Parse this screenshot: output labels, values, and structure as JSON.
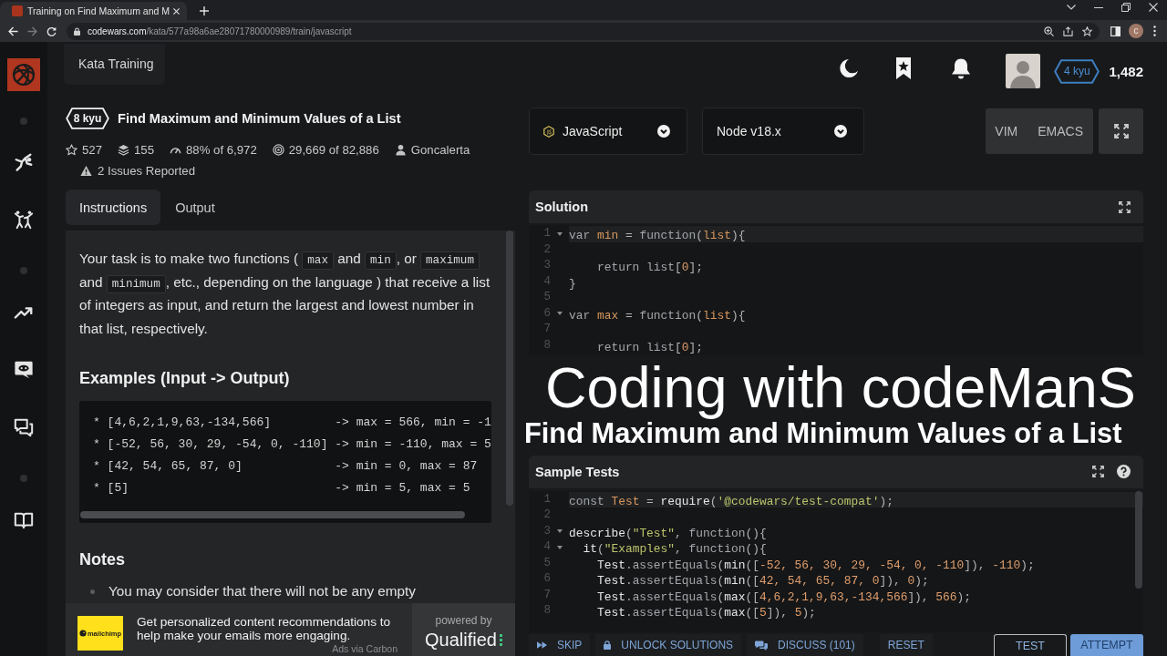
{
  "browser": {
    "tab_title": "Training on Find Maximum and M",
    "url_host": "codewars.com",
    "url_path": "/kata/577a98a6ae28071780000989/train/javascript",
    "back_disabled": false,
    "forward_disabled": true,
    "profile_initial": "c"
  },
  "header": {
    "title": "Kata Training",
    "rank": "4 kyu",
    "honor": "1,482"
  },
  "kata": {
    "rank": "8 kyu",
    "title": "Find Maximum and Minimum Values of a List",
    "stats": [
      {
        "kind": "favorites",
        "text": "527"
      },
      {
        "kind": "collections",
        "text": "155"
      },
      {
        "kind": "satisfaction",
        "text": "88% of 6,972"
      },
      {
        "kind": "completions",
        "text": "29,669 of 82,886"
      },
      {
        "kind": "author",
        "text": "Goncalerta"
      }
    ],
    "issues": "2 Issues Reported"
  },
  "tabs": [
    {
      "label": "Instructions",
      "selected": true
    },
    {
      "label": "Output",
      "selected": false
    }
  ],
  "instructions": {
    "paragraph": [
      {
        "kind": "text",
        "text": "Your task is to make two functions ( "
      },
      {
        "kind": "code",
        "text": "max"
      },
      {
        "kind": "text",
        "text": " and "
      },
      {
        "kind": "code",
        "text": "min"
      },
      {
        "kind": "text",
        "text": ", or "
      },
      {
        "kind": "code",
        "text": "maximum"
      },
      {
        "kind": "text",
        "text": " and "
      },
      {
        "kind": "code",
        "text": "minimum"
      },
      {
        "kind": "text",
        "text": ", etc., depending on the language ) that receive a list of integers as input, and return the largest and lowest number in that list, respectively."
      }
    ],
    "examples_heading": "Examples (Input -> Output)",
    "examples": [
      "* [4,6,2,1,9,63,-134,566]         -> max = 566, min = -1",
      "* [-52, 56, 30, 29, -54, 0, -110] -> min = -110, max = 5",
      "* [42, 54, 65, 87, 0]             -> min = 0, max = 87",
      "* [5]                             -> min = 5, max = 5"
    ],
    "notes_heading": "Notes",
    "notes": [
      "You may consider that there will not be any empty"
    ]
  },
  "ad": {
    "logo_text": "mailchimp",
    "text": "Get personalized content recommendations to help make your emails more engaging.",
    "source": "Ads via Carbon",
    "powered_by": "powered by",
    "brand": "Qualified"
  },
  "editor_toolbar": {
    "language": "JavaScript",
    "runtime": "Node v18.x",
    "modes": [
      "VIM",
      "EMACS"
    ]
  },
  "solution": {
    "title": "Solution",
    "lines": [
      {
        "number": "1",
        "fold": true,
        "active": true,
        "tokens": [
          {
            "kind": "kw",
            "text": "var "
          },
          {
            "kind": "var",
            "text": "min"
          },
          {
            "kind": "punc",
            "text": " = "
          },
          {
            "kind": "kw",
            "text": "function"
          },
          {
            "kind": "punc",
            "text": "("
          },
          {
            "kind": "var",
            "text": "list"
          },
          {
            "kind": "punc",
            "text": "){"
          }
        ]
      },
      {
        "number": "2",
        "fold": false,
        "active": false
      },
      {
        "number": "3",
        "fold": false,
        "active": false,
        "tokens": [
          {
            "kind": "kw",
            "text": "    return list"
          },
          {
            "kind": "punc",
            "text": "["
          },
          {
            "kind": "num",
            "text": "0"
          },
          {
            "kind": "punc",
            "text": "];"
          }
        ]
      },
      {
        "number": "4",
        "fold": false,
        "active": false,
        "tokens": [
          {
            "kind": "punc",
            "text": "}"
          }
        ]
      },
      {
        "number": "5",
        "fold": false,
        "active": false
      },
      {
        "number": "6",
        "fold": true,
        "active": false,
        "tokens": [
          {
            "kind": "kw",
            "text": "var "
          },
          {
            "kind": "var",
            "text": "max"
          },
          {
            "kind": "punc",
            "text": " = "
          },
          {
            "kind": "kw",
            "text": "function"
          },
          {
            "kind": "punc",
            "text": "("
          },
          {
            "kind": "var",
            "text": "list"
          },
          {
            "kind": "punc",
            "text": "){"
          }
        ]
      },
      {
        "number": "7",
        "fold": false,
        "active": false
      },
      {
        "number": "8",
        "fold": false,
        "active": false,
        "tokens": [
          {
            "kind": "kw",
            "text": "    return list"
          },
          {
            "kind": "punc",
            "text": "["
          },
          {
            "kind": "num",
            "text": "0"
          },
          {
            "kind": "punc",
            "text": "];"
          }
        ]
      }
    ]
  },
  "sample_tests": {
    "title": "Sample Tests",
    "lines": [
      {
        "number": "1",
        "fold": false,
        "active": true,
        "tokens": [
          {
            "kind": "kw",
            "text": "const "
          },
          {
            "kind": "var",
            "text": "Test"
          },
          {
            "kind": "punc",
            "text": " = "
          },
          {
            "kind": "fn",
            "text": "require"
          },
          {
            "kind": "punc",
            "text": "("
          },
          {
            "kind": "str",
            "text": "'@codewars/test-compat'"
          },
          {
            "kind": "punc",
            "text": ");"
          }
        ]
      },
      {
        "number": "2",
        "fold": false,
        "active": false
      },
      {
        "number": "3",
        "fold": true,
        "active": false,
        "tokens": [
          {
            "kind": "fn",
            "text": "describe"
          },
          {
            "kind": "punc",
            "text": "("
          },
          {
            "kind": "str",
            "text": "\"Test\""
          },
          {
            "kind": "punc",
            "text": ", "
          },
          {
            "kind": "kw",
            "text": "function"
          },
          {
            "kind": "punc",
            "text": "(){"
          }
        ]
      },
      {
        "number": "4",
        "fold": true,
        "active": false,
        "tokens": [
          {
            "kind": "fn",
            "text": "  it"
          },
          {
            "kind": "punc",
            "text": "("
          },
          {
            "kind": "str",
            "text": "\"Examples\""
          },
          {
            "kind": "punc",
            "text": ", "
          },
          {
            "kind": "kw",
            "text": "function"
          },
          {
            "kind": "punc",
            "text": "(){"
          }
        ]
      },
      {
        "number": "5",
        "fold": false,
        "active": false,
        "tokens": [
          {
            "kind": "fn",
            "text": "    Test"
          },
          {
            "kind": "kw",
            "text": ".assertEquals"
          },
          {
            "kind": "punc",
            "text": "("
          },
          {
            "kind": "fn",
            "text": "min"
          },
          {
            "kind": "punc",
            "text": "(["
          },
          {
            "kind": "num",
            "text": "-52, 56, 30, 29, -54, 0, -110"
          },
          {
            "kind": "punc",
            "text": "]), "
          },
          {
            "kind": "num",
            "text": "-110"
          },
          {
            "kind": "punc",
            "text": ");"
          }
        ]
      },
      {
        "number": "6",
        "fold": false,
        "active": false,
        "tokens": [
          {
            "kind": "fn",
            "text": "    Test"
          },
          {
            "kind": "kw",
            "text": ".assertEquals"
          },
          {
            "kind": "punc",
            "text": "("
          },
          {
            "kind": "fn",
            "text": "min"
          },
          {
            "kind": "punc",
            "text": "(["
          },
          {
            "kind": "num",
            "text": "42, 54, 65, 87, 0"
          },
          {
            "kind": "punc",
            "text": "]), "
          },
          {
            "kind": "num",
            "text": "0"
          },
          {
            "kind": "punc",
            "text": ");"
          }
        ]
      },
      {
        "number": "7",
        "fold": false,
        "active": false,
        "tokens": [
          {
            "kind": "fn",
            "text": "    Test"
          },
          {
            "kind": "kw",
            "text": ".assertEquals"
          },
          {
            "kind": "punc",
            "text": "("
          },
          {
            "kind": "fn",
            "text": "max"
          },
          {
            "kind": "punc",
            "text": "(["
          },
          {
            "kind": "num",
            "text": "4,6,2,1,9,63,-134,566"
          },
          {
            "kind": "punc",
            "text": "]), "
          },
          {
            "kind": "num",
            "text": "566"
          },
          {
            "kind": "punc",
            "text": ");"
          }
        ]
      },
      {
        "number": "8",
        "fold": false,
        "active": false,
        "tokens": [
          {
            "kind": "fn",
            "text": "    Test"
          },
          {
            "kind": "kw",
            "text": ".assertEquals"
          },
          {
            "kind": "punc",
            "text": "("
          },
          {
            "kind": "fn",
            "text": "max"
          },
          {
            "kind": "punc",
            "text": "(["
          },
          {
            "kind": "num",
            "text": "5"
          },
          {
            "kind": "punc",
            "text": "]), "
          },
          {
            "kind": "num",
            "text": "5"
          },
          {
            "kind": "punc",
            "text": ");"
          }
        ]
      }
    ]
  },
  "actions": [
    {
      "kind": "skip",
      "label": "SKIP"
    },
    {
      "kind": "unlock",
      "label": "UNLOCK SOLUTIONS"
    },
    {
      "kind": "discuss",
      "label": "DISCUSS (101)"
    },
    {
      "kind": "reset",
      "label": "RESET"
    }
  ],
  "buttons": [
    {
      "kind": "test",
      "label": "TEST"
    },
    {
      "kind": "attempt",
      "label": "ATTEMPT"
    }
  ],
  "video_overlay": {
    "title": "Coding with codeManS",
    "subtitle": "Find Maximum and Minimum Values of a List"
  }
}
